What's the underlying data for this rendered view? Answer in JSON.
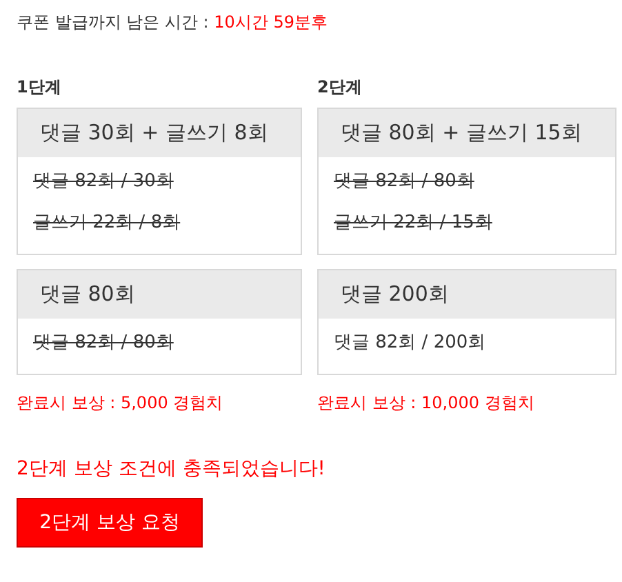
{
  "timer": {
    "label": "쿠폰 발급까지 남은 시간 :",
    "value": "10시간 59분후"
  },
  "stages": [
    {
      "label": "1단계",
      "cards": [
        {
          "title": "댓글 30회 + 글쓰기 8회",
          "progress": [
            {
              "text": "댓글 82회 / 30회",
              "done": true
            },
            {
              "text": "글쓰기 22회 / 8회",
              "done": true
            }
          ]
        },
        {
          "title": "댓글 80회",
          "progress": [
            {
              "text": "댓글 82회 / 80회",
              "done": true
            }
          ]
        }
      ],
      "reward": "완료시 보상 : 5,000 경험치"
    },
    {
      "label": "2단계",
      "cards": [
        {
          "title": "댓글 80회 + 글쓰기 15회",
          "progress": [
            {
              "text": "댓글 82회 / 80회",
              "done": true
            },
            {
              "text": "글쓰기 22회 / 15회",
              "done": true
            }
          ]
        },
        {
          "title": "댓글 200회",
          "progress": [
            {
              "text": "댓글 82회 / 200회",
              "done": false
            }
          ]
        }
      ],
      "reward": "완료시 보상 : 10,000 경험치"
    }
  ],
  "message": "2단계 보상 조건에 충족되었습니다!",
  "button": "2단계 보상 요청"
}
